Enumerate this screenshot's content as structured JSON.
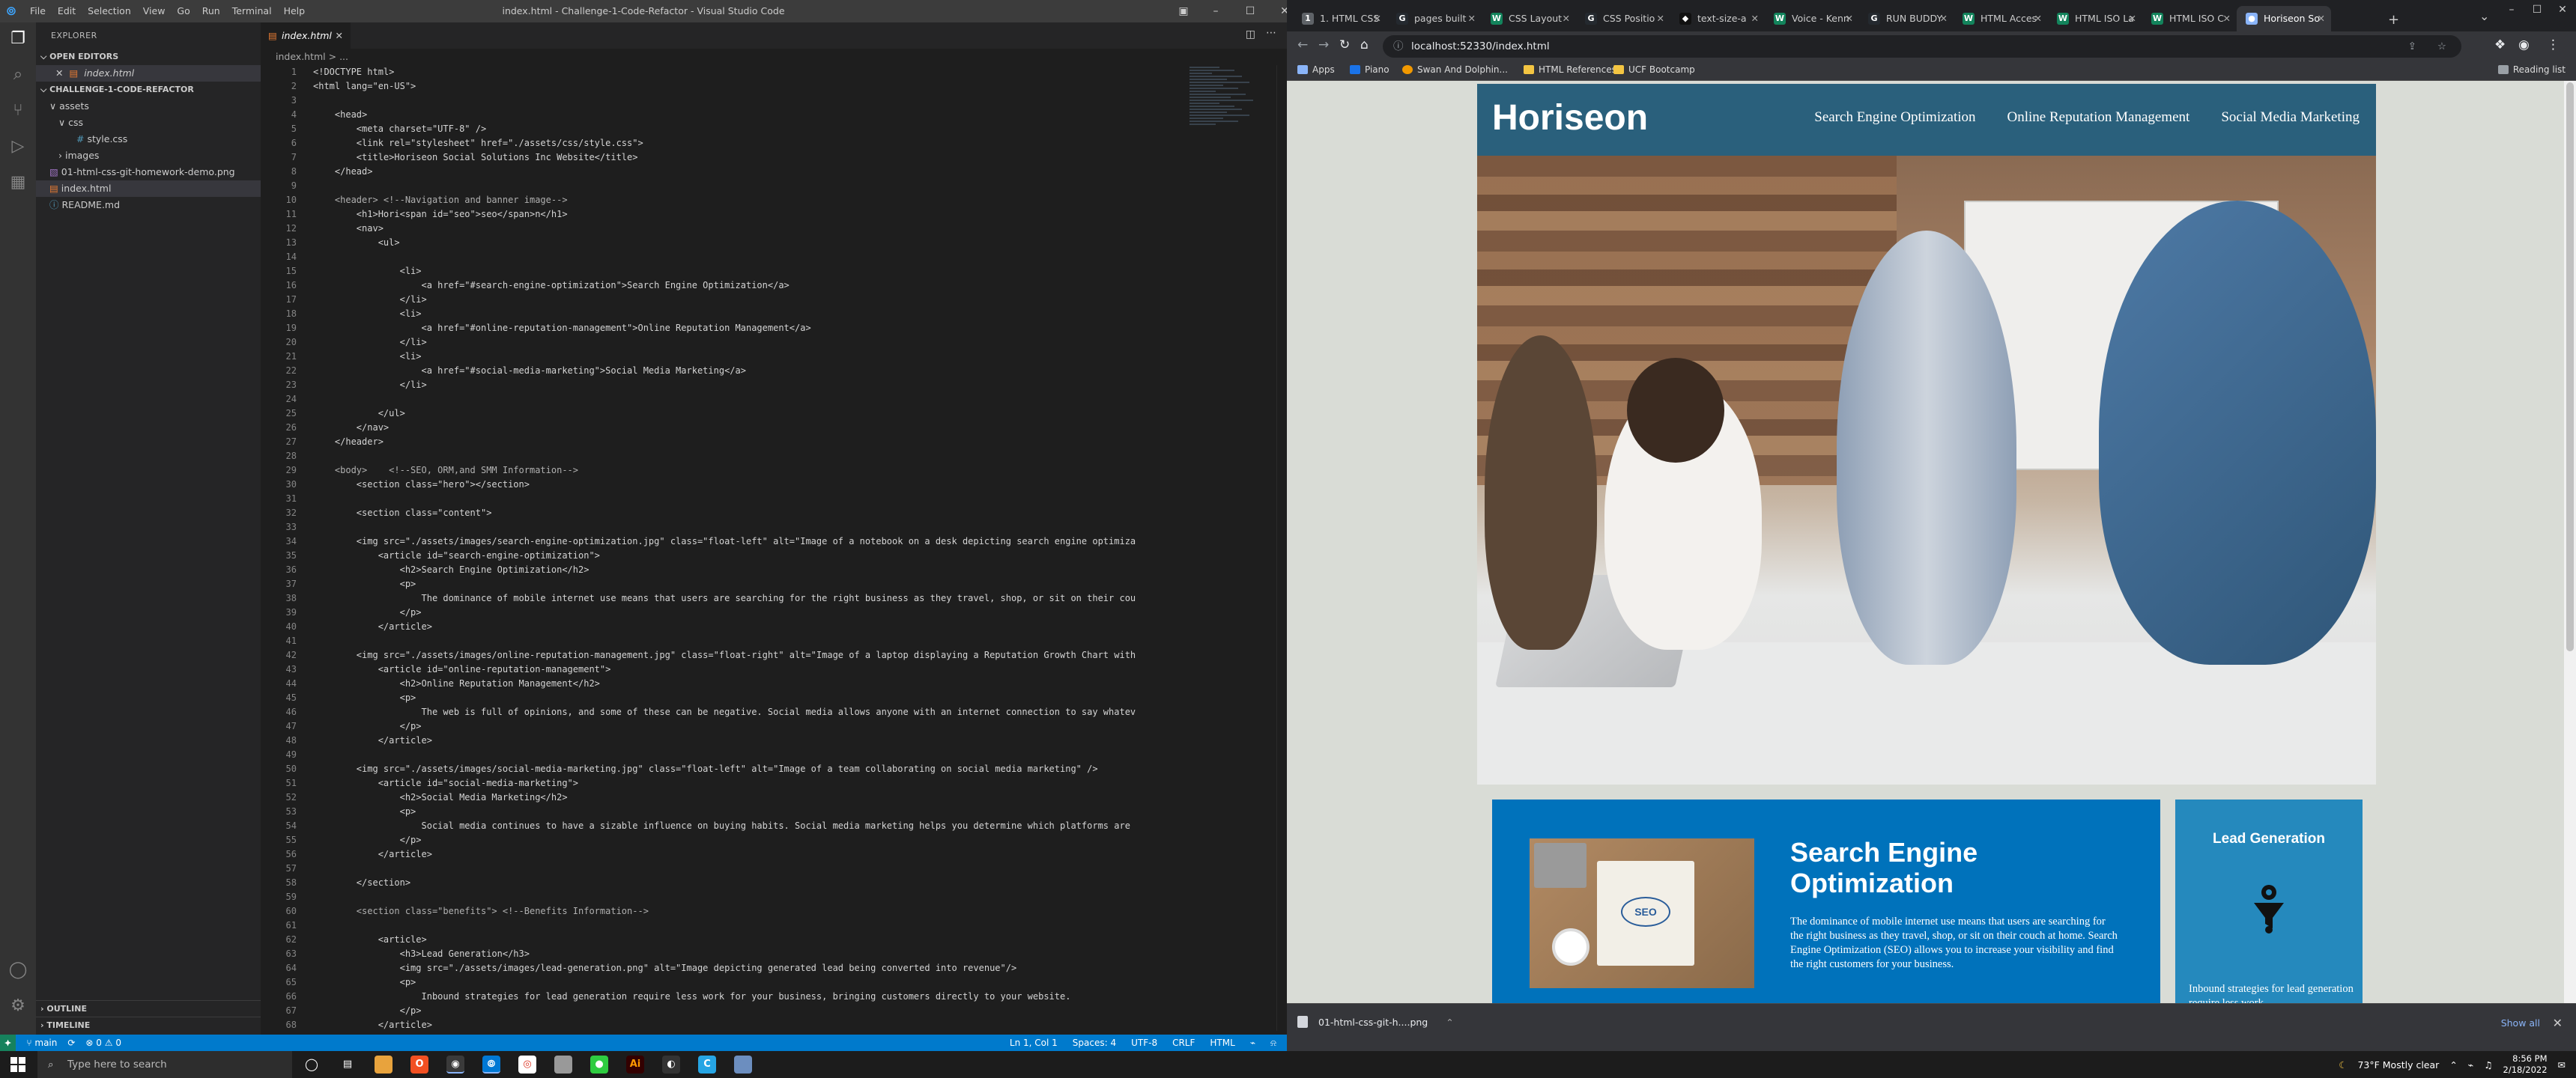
{
  "vscode": {
    "window_title": "index.html - Challenge-1-Code-Refactor - Visual Studio Code",
    "menu": [
      "File",
      "Edit",
      "Selection",
      "View",
      "Go",
      "Run",
      "Terminal",
      "Help"
    ],
    "explorer": {
      "header": "EXPLORER",
      "open_editors": "OPEN EDITORS",
      "open_file": "index.html",
      "project": "CHALLENGE-1-CODE-REFACTOR",
      "tree": [
        {
          "label": "assets",
          "depth": 1,
          "type": "folder-open"
        },
        {
          "label": "css",
          "depth": 2,
          "type": "folder-open"
        },
        {
          "label": "style.css",
          "depth": 3,
          "type": "css"
        },
        {
          "label": "images",
          "depth": 2,
          "type": "folder"
        },
        {
          "label": "01-html-css-git-homework-demo.png",
          "depth": 1,
          "type": "img"
        },
        {
          "label": "index.html",
          "depth": 1,
          "type": "html",
          "selected": true
        },
        {
          "label": "README.md",
          "depth": 1,
          "type": "md"
        }
      ],
      "outline": "OUTLINE",
      "timeline": "TIMELINE"
    },
    "tab": {
      "label": "index.html"
    },
    "breadcrumb": "index.html > ...",
    "code_lines": [
      "<!DOCTYPE html>",
      "<html lang=\"en-US\">",
      "",
      "    <head>",
      "        <meta charset=\"UTF-8\" />",
      "        <link rel=\"stylesheet\" href=\"./assets/css/style.css\">",
      "        <title>Horiseon Social Solutions Inc Website</title>",
      "    </head>",
      "",
      "    <header> <!--Navigation and banner image-->",
      "        <h1>Hori<span id=\"seo\">seo</span>n</h1>",
      "        <nav>",
      "            <ul>",
      "",
      "                <li>",
      "                    <a href=\"#search-engine-optimization\">Search Engine Optimization</a>",
      "                </li>",
      "                <li>",
      "                    <a href=\"#online-reputation-management\">Online Reputation Management</a>",
      "                </li>",
      "                <li>",
      "                    <a href=\"#social-media-marketing\">Social Media Marketing</a>",
      "                </li>",
      "",
      "            </ul>",
      "        </nav>",
      "    </header>",
      "",
      "    <body>    <!--SEO, ORM,and SMM Information-->",
      "        <section class=\"hero\"></section>",
      "",
      "        <section class=\"content\">",
      "",
      "        <img src=\"./assets/images/search-engine-optimization.jpg\" class=\"float-left\" alt=\"Image of a notebook on a desk depicting search engine optimiza",
      "            <article id=\"search-engine-optimization\">",
      "                <h2>Search Engine Optimization</h2>",
      "                <p>",
      "                    The dominance of mobile internet use means that users are searching for the right business as they travel, shop, or sit on their cou",
      "                </p>",
      "            </article>",
      "",
      "        <img src=\"./assets/images/online-reputation-management.jpg\" class=\"float-right\" alt=\"Image of a laptop displaying a Reputation Growth Chart with",
      "            <article id=\"online-reputation-management\">",
      "                <h2>Online Reputation Management</h2>",
      "                <p>",
      "                    The web is full of opinions, and some of these can be negative. Social media allows anyone with an internet connection to say whatev",
      "                </p>",
      "            </article>",
      "",
      "        <img src=\"./assets/images/social-media-marketing.jpg\" class=\"float-left\" alt=\"Image of a team collaborating on social media marketing\" />",
      "            <article id=\"social-media-marketing\">",
      "                <h2>Social Media Marketing</h2>",
      "                <p>",
      "                    Social media continues to have a sizable influence on buying habits. Social media marketing helps you determine which platforms are",
      "                </p>",
      "            </article>",
      "",
      "        </section>",
      "",
      "        <section class=\"benefits\"> <!--Benefits Information-->",
      "",
      "            <article>",
      "                <h3>Lead Generation</h3>",
      "                <img src=\"./assets/images/lead-generation.png\" alt=\"Image depicting generated lead being converted into revenue\"/>",
      "                <p>",
      "                    Inbound strategies for lead generation require less work for your business, bringing customers directly to your website.",
      "                </p>",
      "            </article>"
    ],
    "status": {
      "branch": "main",
      "problems": "0 ⚠ 0",
      "position": "Ln 1, Col 1",
      "spaces": "Spaces: 4",
      "encoding": "UTF-8",
      "eol": "CRLF",
      "lang": "HTML"
    }
  },
  "chrome": {
    "tabs": [
      {
        "label": "1. HTML CSS",
        "fav": "1",
        "color": "#5f6368"
      },
      {
        "label": "pages built",
        "fav": "G",
        "color": "#24292f"
      },
      {
        "label": "CSS Layout",
        "fav": "W",
        "color": "#13845c"
      },
      {
        "label": "CSS Positio",
        "fav": "G",
        "color": "#24292f"
      },
      {
        "label": "text-size-a",
        "fav": "◆",
        "color": "#111"
      },
      {
        "label": "Voice - Kenn",
        "fav": "W",
        "color": "#13845c"
      },
      {
        "label": "RUN BUDDY",
        "fav": "G",
        "color": "#24292f"
      },
      {
        "label": "HTML Acces",
        "fav": "W",
        "color": "#13845c"
      },
      {
        "label": "HTML ISO La",
        "fav": "W",
        "color": "#13845c"
      },
      {
        "label": "HTML ISO C",
        "fav": "W",
        "color": "#13845c"
      },
      {
        "label": "Horiseon So",
        "fav": "●",
        "color": "#8ab4f8",
        "active": true
      }
    ],
    "url": "localhost:52330/index.html",
    "bookmarks": [
      "Apps",
      "Piano",
      "Swan And Dolphin...",
      "HTML References",
      "UCF Bootcamp"
    ],
    "reading_list": "Reading list",
    "download": {
      "file": "01-html-css-git-h....png",
      "show_all": "Show all"
    }
  },
  "site": {
    "logo": "Horiseon",
    "nav": [
      "Search Engine Optimization",
      "Online Reputation Management",
      "Social Media Marketing"
    ],
    "seo_heading": "Search Engine Optimization",
    "seo_text": "The dominance of mobile internet use means that users are searching for the right business as they travel, shop, or sit on their couch at home. Search Engine Optimization (SEO) allows you to increase your visibility and find the right customers for your business.",
    "seo_img_text": "SEO",
    "lead_heading": "Lead Generation",
    "lead_text": "Inbound strategies for lead generation require less work"
  },
  "taskbar": {
    "search_placeholder": "Type here to search",
    "weather": "73°F  Mostly clear",
    "time": "8:56 PM",
    "date": "2/18/2022"
  },
  "colors": {
    "vscode_accent": "#007acc",
    "site_header": "#2a607c",
    "seo_card": "#0072bb",
    "lead_card": "#2589bd"
  }
}
